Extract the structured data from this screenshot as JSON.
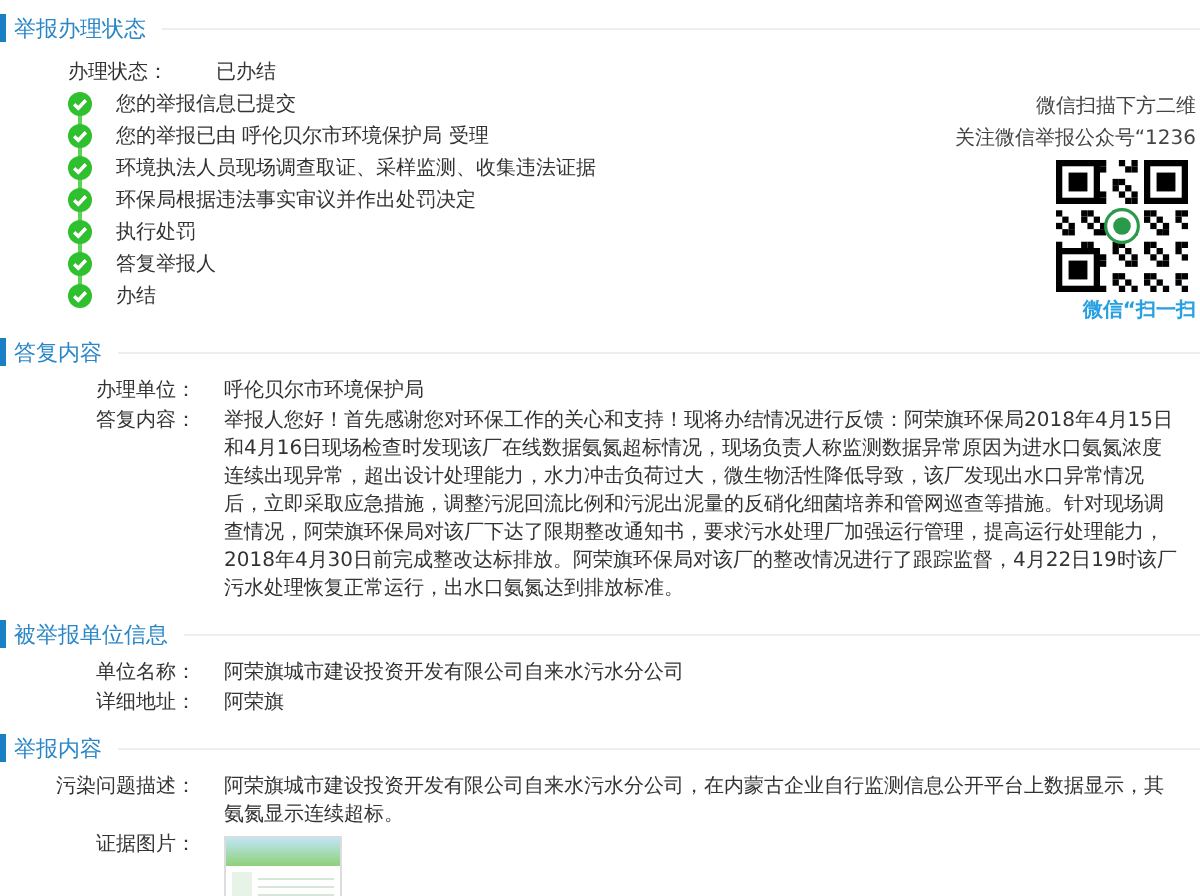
{
  "status_section": {
    "title": "举报办理状态",
    "status_label": "办理状态：",
    "status_value": "已办结",
    "steps": [
      {
        "text": "您的举报信息已提交",
        "done": true
      },
      {
        "text": "您的举报已由 呼伦贝尔市环境保护局 受理",
        "done": true
      },
      {
        "text": "环境执法人员现场调查取证、采样监测、收集违法证据",
        "done": true
      },
      {
        "text": "环保局根据违法事实审议并作出处罚决定",
        "done": true
      },
      {
        "text": "执行处罚",
        "done": true
      },
      {
        "text": "答复举报人",
        "done": true
      },
      {
        "text": "办结",
        "done": true
      }
    ],
    "qr": {
      "caption_top": "微信扫描下方二维",
      "caption_account": "关注微信举报公众号“1236",
      "caption_bottom": "微信“扫一扫"
    }
  },
  "sections": [
    {
      "title": "答复内容",
      "fields": [
        {
          "kind": "text",
          "label": "办理单位：",
          "value": "呼伦贝尔市环境保护局"
        },
        {
          "kind": "text",
          "label": "答复内容：",
          "value": "举报人您好！首先感谢您对环保工作的关心和支持！现将办结情况进行反馈：阿荣旗环保局2018年4月15日和4月16日现场检查时发现该厂在线数据氨氮超标情况，现场负责人称监测数据异常原因为进水口氨氮浓度连续出现异常，超出设计处理能力，水力冲击负荷过大，微生物活性降低导致，该厂发现出水口异常情况后，立即采取应急措施，调整污泥回流比例和污泥出泥量的反硝化细菌培养和管网巡查等措施。针对现场调查情况，阿荣旗环保局对该厂下达了限期整改通知书，要求污水处理厂加强运行管理，提高运行处理能力，2018年4月30日前完成整改达标排放。阿荣旗环保局对该厂的整改情况进行了跟踪监督，4月22日19时该厂污水处理恢复正常运行，出水口氨氮达到排放标准。"
        }
      ]
    },
    {
      "title": "被举报单位信息",
      "fields": [
        {
          "kind": "text",
          "label": "单位名称：",
          "value": "阿荣旗城市建设投资开发有限公司自来水污水分公司"
        },
        {
          "kind": "text",
          "label": "详细地址：",
          "value": "阿荣旗"
        }
      ]
    },
    {
      "title": "举报内容",
      "fields": [
        {
          "kind": "text",
          "label": "污染问题描述：",
          "value": "阿荣旗城市建设投资开发有限公司自来水污水分公司，在内蒙古企业自行监测信息公开平台上数据显示，其氨氮显示连续超标。"
        },
        {
          "kind": "image",
          "label": "证据图片："
        }
      ]
    }
  ]
}
